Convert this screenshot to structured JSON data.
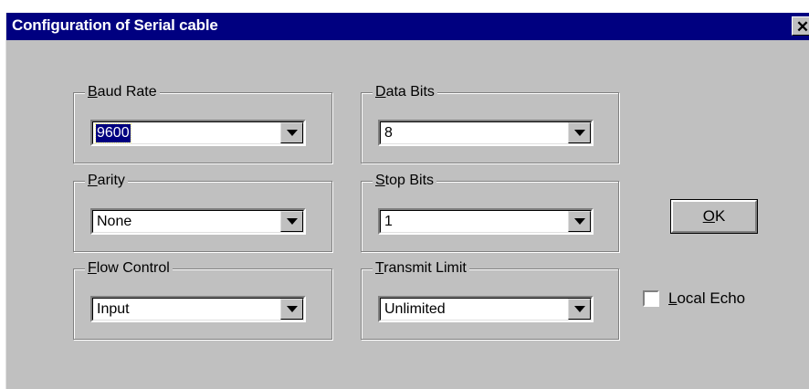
{
  "window": {
    "title": "Configuration of Serial cable",
    "close_glyph": "✕"
  },
  "groups": {
    "baud_rate": {
      "label_mnemonic": "B",
      "label_rest": "aud Rate",
      "value": "9600"
    },
    "data_bits": {
      "label_mnemonic": "D",
      "label_rest": "ata Bits",
      "value": "8"
    },
    "parity": {
      "label_mnemonic": "P",
      "label_rest": "arity",
      "value": "None"
    },
    "stop_bits": {
      "label_mnemonic": "S",
      "label_rest": "top Bits",
      "value": "1"
    },
    "flow_control": {
      "label_mnemonic": "F",
      "label_rest": "low Control",
      "value": "Input"
    },
    "transmit_limit": {
      "label_mnemonic": "T",
      "label_rest": "ransmit Limit",
      "value": "Unlimited"
    }
  },
  "ok_button": {
    "mnemonic": "O",
    "rest": "K"
  },
  "local_echo": {
    "mnemonic": "L",
    "rest": "ocal Echo",
    "checked": false
  }
}
